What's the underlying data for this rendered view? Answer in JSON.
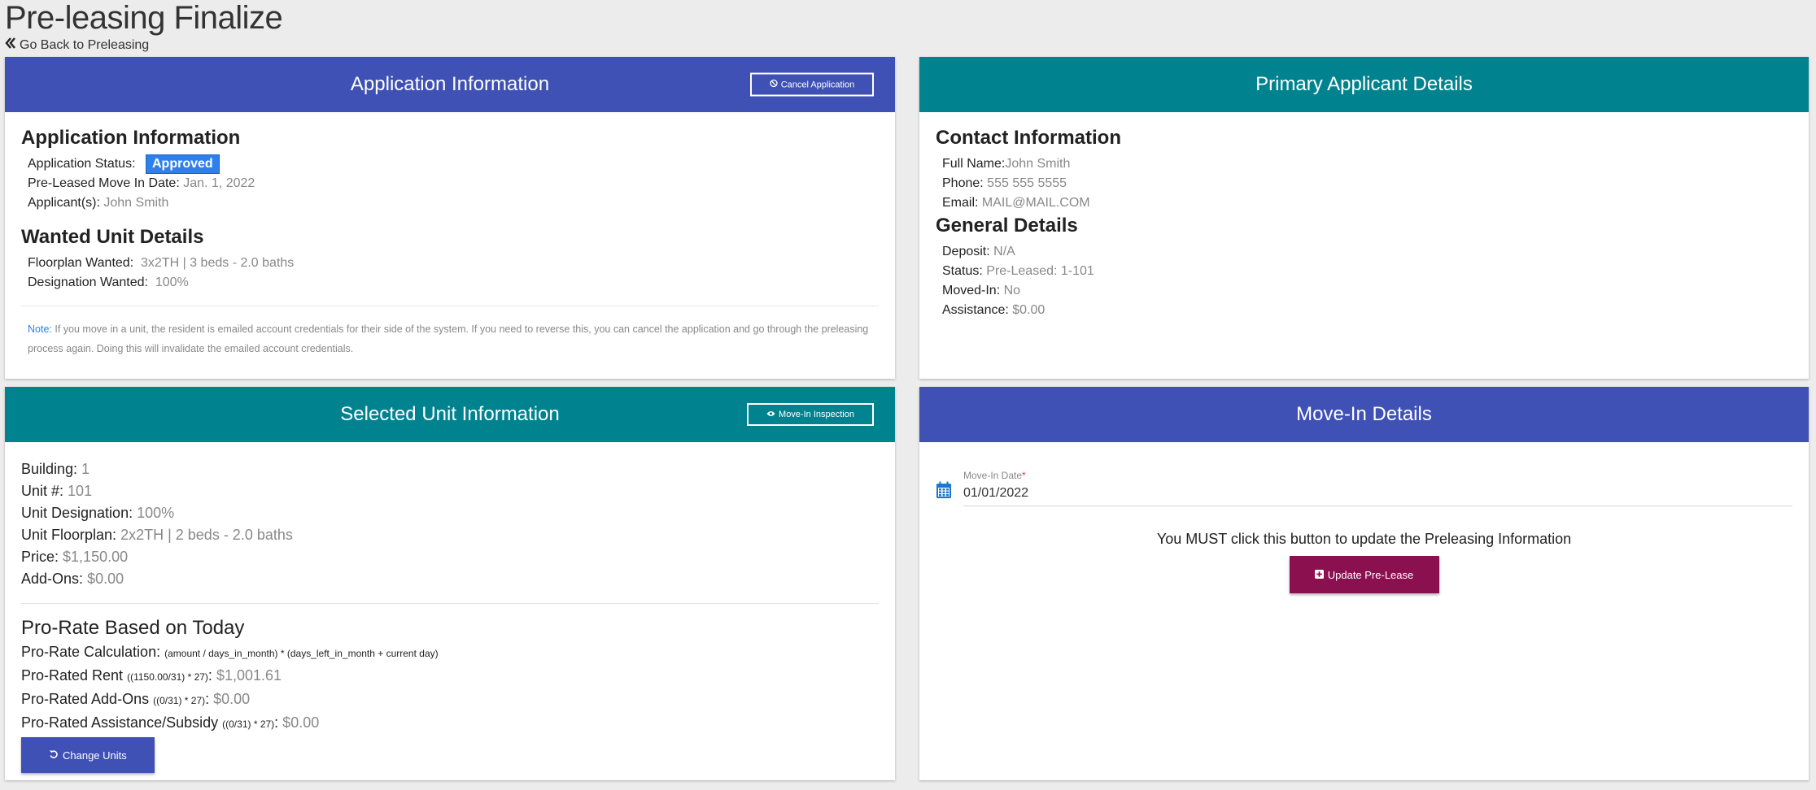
{
  "page": {
    "title": "Pre-leasing Finalize",
    "back_link": "Go Back to Preleasing"
  },
  "colors": {
    "blue": "#3f51b5",
    "teal": "#00838f",
    "maroon": "#8b1050",
    "badge": "#2f80ed"
  },
  "application_card": {
    "header": "Application Information",
    "cancel_button": "Cancel Application",
    "section_title": "Application Information",
    "status_label": "Application Status:",
    "status_value": "Approved",
    "movein_label": "Pre-Leased Move In Date:",
    "movein_value": "Jan. 1, 2022",
    "applicants_label": "Applicant(s):",
    "applicants_value": "John Smith",
    "wanted_title": "Wanted Unit Details",
    "floorplan_label": "Floorplan Wanted:",
    "floorplan_value": "3x2TH | 3 beds - 2.0 baths",
    "designation_label": "Designation Wanted:",
    "designation_value": "100%",
    "note_label": "Note:",
    "note_text": "If you move in a unit, the resident is emailed account credentials for their side of the system. If you need to reverse this, you can cancel the application and go through the preleasing process again. Doing this will invalidate the emailed account credentials."
  },
  "applicant_card": {
    "header": "Primary Applicant Details",
    "contact_title": "Contact Information",
    "fullname_label": "Full Name:",
    "fullname_value": "John Smith",
    "phone_label": "Phone:",
    "phone_value": "555 555 5555",
    "email_label": "Email:",
    "email_value": "MAIL@MAIL.COM",
    "general_title": "General Details",
    "deposit_label": "Deposit:",
    "deposit_value": "N/A",
    "status_label": "Status:",
    "status_value": "Pre-Leased: 1-101",
    "movedin_label": "Moved-In:",
    "movedin_value": "No",
    "assistance_label": "Assistance:",
    "assistance_value": "$0.00"
  },
  "unit_card": {
    "header": "Selected Unit Information",
    "inspection_button": "Move-In Inspection",
    "building_label": "Building:",
    "building_value": "1",
    "unit_label": "Unit #:",
    "unit_value": "101",
    "designation_label": "Unit Designation:",
    "designation_value": "100%",
    "floorplan_label": "Unit Floorplan:",
    "floorplan_value": "2x2TH | 2 beds - 2.0 baths",
    "price_label": "Price:",
    "price_value": "$1,150.00",
    "addons_label": "Add-Ons:",
    "addons_value": "$0.00",
    "prorate_title": "Pro-Rate Based on Today",
    "calc_label": "Pro-Rate Calculation:",
    "calc_formula": "(amount / days_in_month) * (days_left_in_month + current day)",
    "rent_label": "Pro-Rated Rent",
    "rent_formula": "((1150.00/31) * 27)",
    "rent_value": "$1,001.61",
    "pr_addons_label": "Pro-Rated Add-Ons",
    "pr_addons_formula": "((0/31) * 27)",
    "pr_addons_value": "$0.00",
    "pr_assist_label": "Pro-Rated Assistance/Subsidy",
    "pr_assist_formula": "((0/31) * 27)",
    "pr_assist_value": "$0.00",
    "change_button": "Change Units"
  },
  "movein_card": {
    "header": "Move-In Details",
    "date_label": "Move-In Date",
    "date_required": "*",
    "date_value": "01/01/2022",
    "must_text": "You MUST click this button to update the Preleasing Information",
    "update_button": "Update Pre-Lease"
  }
}
